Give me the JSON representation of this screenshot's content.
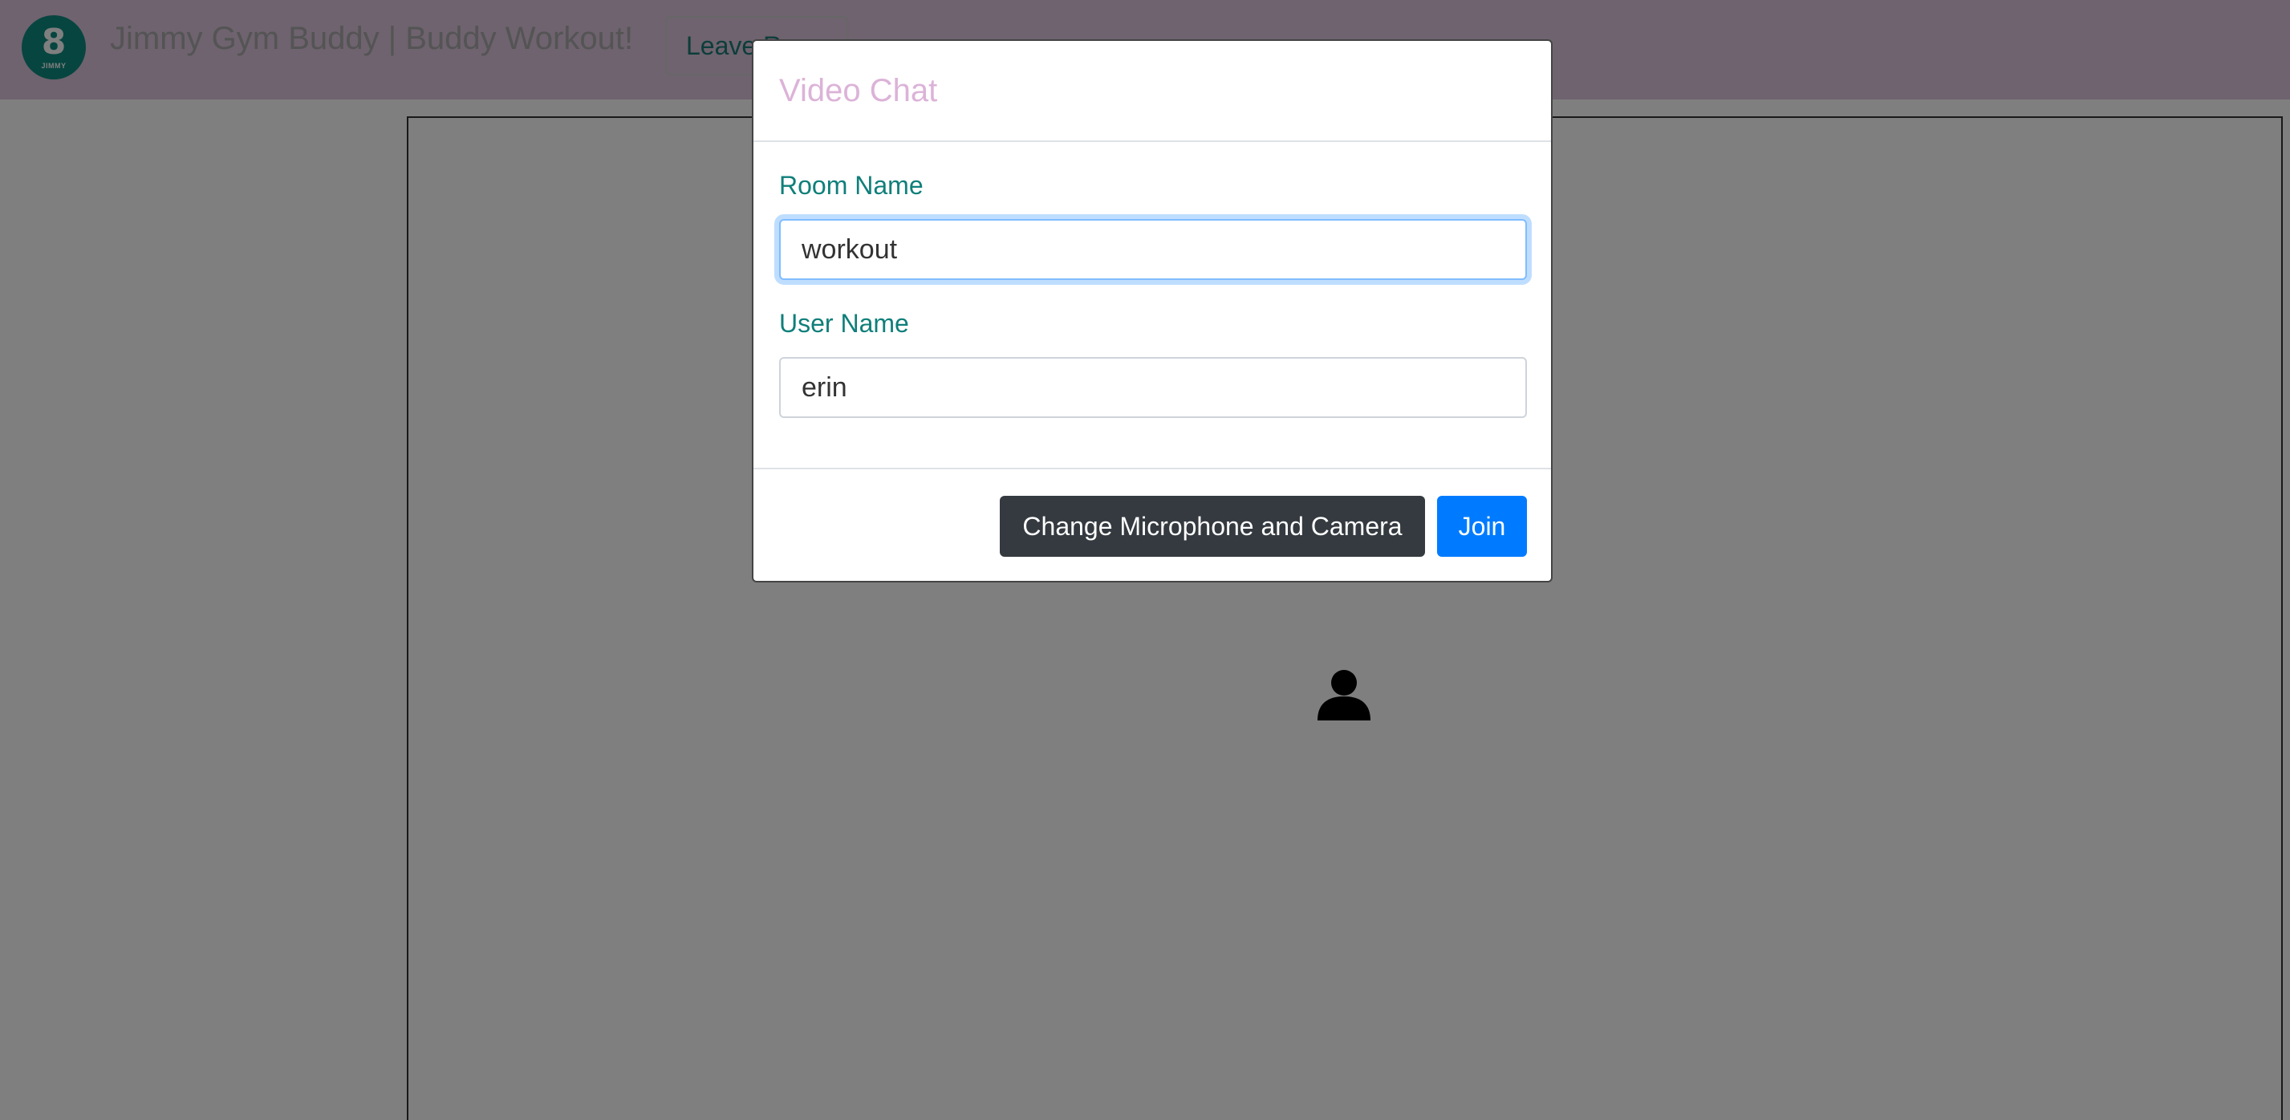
{
  "navbar": {
    "logo_text": "JIMMY",
    "brand_title": "Jimmy Gym Buddy | Buddy Workout!",
    "leave_button_label": "Leave Room"
  },
  "modal": {
    "title": "Video Chat",
    "room_name_label": "Room Name",
    "room_name_value": "workout",
    "user_name_label": "User Name",
    "user_name_value": "erin",
    "change_devices_label": "Change Microphone and Camera",
    "join_label": "Join"
  },
  "icons": {
    "logo": "kettlebell-logo-icon",
    "participant": "person-icon"
  },
  "colors": {
    "navbar_bg": "#dcc6dc",
    "accent_teal": "#0f7f7a",
    "title_pink": "#dcb3d8",
    "primary_button": "#007bff",
    "dark_button": "#343a40"
  }
}
